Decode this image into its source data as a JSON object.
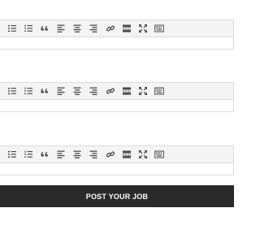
{
  "editors": [
    {
      "toolbar": [
        "unordered-list-icon",
        "ordered-list-icon",
        "quote-icon",
        "align-left-icon",
        "align-center-icon",
        "align-right-icon",
        "link-icon",
        "read-more-icon",
        "fullscreen-icon",
        "keyboard-icon"
      ]
    },
    {
      "toolbar": [
        "unordered-list-icon",
        "ordered-list-icon",
        "quote-icon",
        "align-left-icon",
        "align-center-icon",
        "align-right-icon",
        "link-icon",
        "read-more-icon",
        "fullscreen-icon",
        "keyboard-icon"
      ]
    },
    {
      "toolbar": [
        "unordered-list-icon",
        "ordered-list-icon",
        "quote-icon",
        "align-left-icon",
        "align-center-icon",
        "align-right-icon",
        "link-icon",
        "read-more-icon",
        "fullscreen-icon",
        "keyboard-icon"
      ]
    }
  ],
  "submit": {
    "label": "POST YOUR JOB"
  },
  "colors": {
    "icon": "#4a4a4a",
    "toolbar_bg": "#f4f4f4",
    "button_bg": "#2a2a2a",
    "button_text": "#ffffff"
  }
}
